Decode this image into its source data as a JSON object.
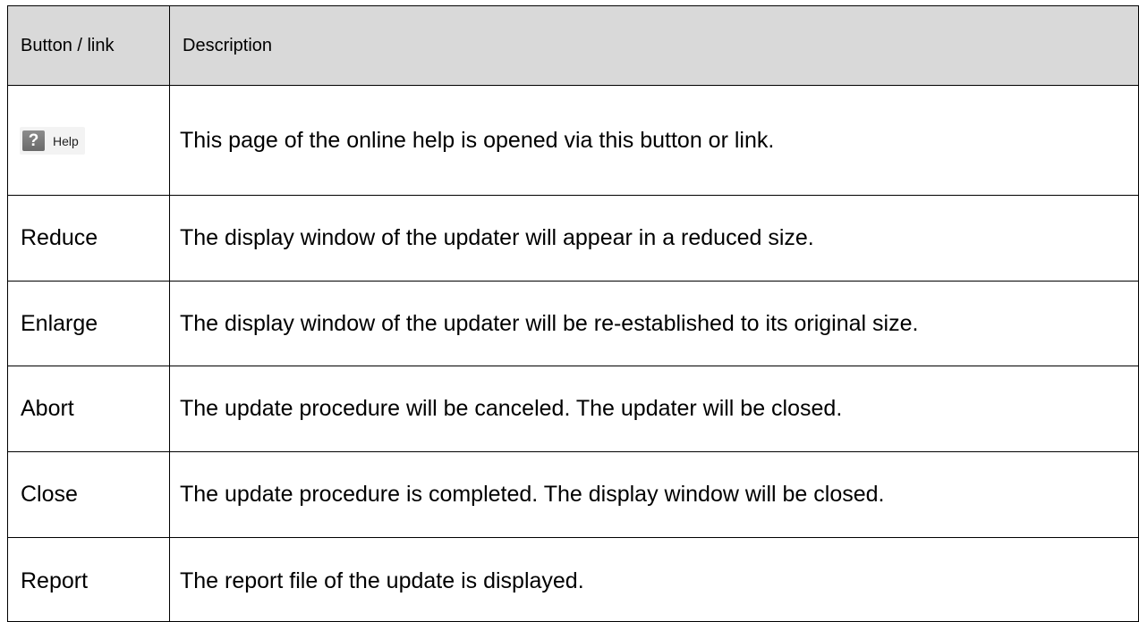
{
  "table": {
    "headers": {
      "button": "Button / link",
      "description": "Description"
    },
    "help_row": {
      "icon": "question-mark-icon",
      "label": "Help",
      "description": "This page of the online help is opened via this button or link."
    },
    "rows": [
      {
        "button": "Reduce",
        "description": "The display window of the updater will appear in a reduced size."
      },
      {
        "button": "Enlarge",
        "description": "The display window of the updater will be re-established to its original size."
      },
      {
        "button": "Abort",
        "description": "The update procedure will be canceled. The updater will be closed."
      },
      {
        "button": "Close",
        "description": "The update procedure is completed. The display window will be closed."
      },
      {
        "button": "Report",
        "description": "The report file of the update is displayed."
      }
    ]
  }
}
